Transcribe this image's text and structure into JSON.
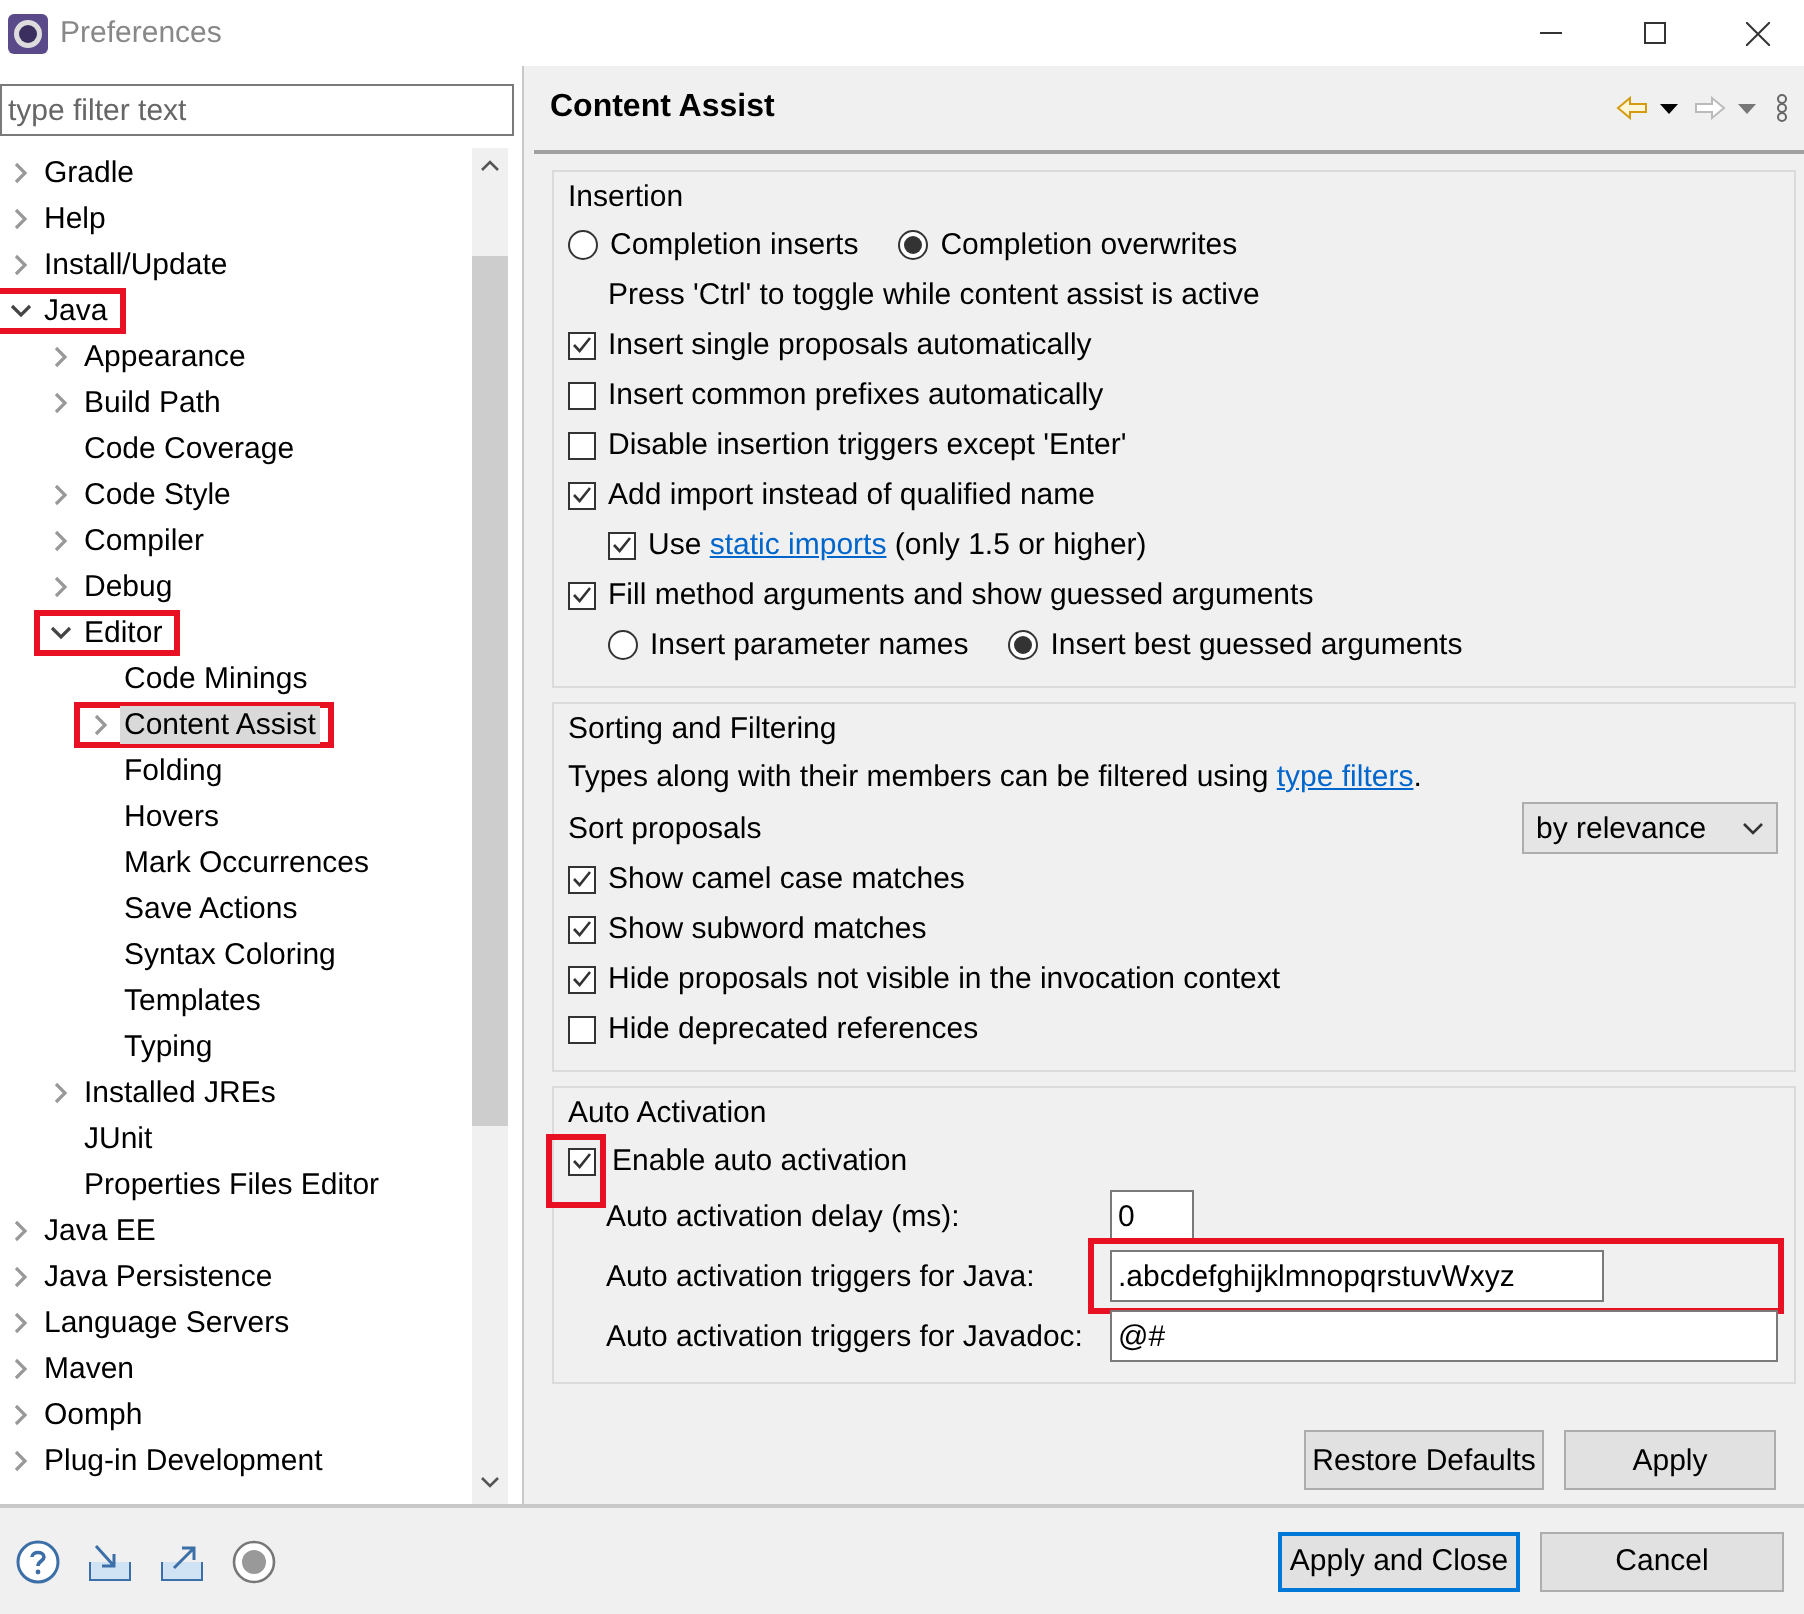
{
  "window": {
    "title": "Preferences"
  },
  "filter": {
    "placeholder": "type filter text"
  },
  "tree": [
    {
      "label": "Gradle",
      "kind": "branch",
      "expanded": false,
      "selected": false,
      "highlighted": false
    },
    {
      "label": "Help",
      "kind": "branch",
      "expanded": false,
      "selected": false,
      "highlighted": false
    },
    {
      "label": "Install/Update",
      "kind": "branch",
      "expanded": false,
      "selected": false,
      "highlighted": false
    },
    {
      "label": "Java",
      "kind": "branch",
      "expanded": true,
      "selected": false,
      "highlighted": true,
      "children": [
        {
          "label": "Appearance",
          "kind": "branch",
          "expanded": false,
          "selected": false,
          "highlighted": false
        },
        {
          "label": "Build Path",
          "kind": "branch",
          "expanded": false,
          "selected": false,
          "highlighted": false
        },
        {
          "label": "Code Coverage",
          "kind": "leaf",
          "selected": false,
          "highlighted": false
        },
        {
          "label": "Code Style",
          "kind": "branch",
          "expanded": false,
          "selected": false,
          "highlighted": false
        },
        {
          "label": "Compiler",
          "kind": "branch",
          "expanded": false,
          "selected": false,
          "highlighted": false
        },
        {
          "label": "Debug",
          "kind": "branch",
          "expanded": false,
          "selected": false,
          "highlighted": false
        },
        {
          "label": "Editor",
          "kind": "branch",
          "expanded": true,
          "selected": false,
          "highlighted": true,
          "children": [
            {
              "label": "Code Minings",
              "kind": "leaf",
              "selected": false,
              "highlighted": false
            },
            {
              "label": "Content Assist",
              "kind": "branch",
              "expanded": false,
              "selected": true,
              "highlighted": true
            },
            {
              "label": "Folding",
              "kind": "leaf",
              "selected": false,
              "highlighted": false
            },
            {
              "label": "Hovers",
              "kind": "leaf",
              "selected": false,
              "highlighted": false
            },
            {
              "label": "Mark Occurrences",
              "kind": "leaf",
              "selected": false,
              "highlighted": false
            },
            {
              "label": "Save Actions",
              "kind": "leaf",
              "selected": false,
              "highlighted": false
            },
            {
              "label": "Syntax Coloring",
              "kind": "leaf",
              "selected": false,
              "highlighted": false
            },
            {
              "label": "Templates",
              "kind": "leaf",
              "selected": false,
              "highlighted": false
            },
            {
              "label": "Typing",
              "kind": "leaf",
              "selected": false,
              "highlighted": false
            }
          ]
        },
        {
          "label": "Installed JREs",
          "kind": "branch",
          "expanded": false,
          "selected": false,
          "highlighted": false
        },
        {
          "label": "JUnit",
          "kind": "leaf",
          "selected": false,
          "highlighted": false
        },
        {
          "label": "Properties Files Editor",
          "kind": "leaf",
          "selected": false,
          "highlighted": false
        }
      ]
    },
    {
      "label": "Java EE",
      "kind": "branch",
      "expanded": false,
      "selected": false,
      "highlighted": false
    },
    {
      "label": "Java Persistence",
      "kind": "branch",
      "expanded": false,
      "selected": false,
      "highlighted": false
    },
    {
      "label": "Language Servers",
      "kind": "branch",
      "expanded": false,
      "selected": false,
      "highlighted": false
    },
    {
      "label": "Maven",
      "kind": "branch",
      "expanded": false,
      "selected": false,
      "highlighted": false
    },
    {
      "label": "Oomph",
      "kind": "branch",
      "expanded": false,
      "selected": false,
      "highlighted": false
    },
    {
      "label": "Plug-in Development",
      "kind": "branch",
      "expanded": false,
      "selected": false,
      "highlighted": false
    }
  ],
  "page": {
    "title": "Content Assist",
    "groups": [
      {
        "title": "Insertion",
        "rows": [
          {
            "kind": "radios",
            "options": [
              {
                "label": "Completion inserts",
                "selected": false
              },
              {
                "label": "Completion overwrites",
                "selected": true
              }
            ]
          },
          {
            "kind": "note",
            "text": "Press 'Ctrl' to toggle while content assist is active"
          },
          {
            "kind": "checkbox",
            "label": "Insert single proposals automatically",
            "checked": true
          },
          {
            "kind": "checkbox",
            "label": "Insert common prefixes automatically",
            "checked": false
          },
          {
            "kind": "checkbox",
            "label": "Disable insertion triggers except 'Enter'",
            "checked": false
          },
          {
            "kind": "checkbox",
            "label": "Add import instead of qualified name",
            "checked": true,
            "children": [
              {
                "kind": "checkbox",
                "label": "Use",
                "link": "static imports",
                "label_after": "(only 1.5 or higher)",
                "checked": true
              }
            ]
          },
          {
            "kind": "checkbox",
            "label": "Fill method arguments and show guessed arguments",
            "checked": true,
            "children": [
              {
                "kind": "radios",
                "options": [
                  {
                    "label": "Insert parameter names",
                    "selected": false
                  },
                  {
                    "label": "Insert best guessed arguments",
                    "selected": true
                  }
                ]
              }
            ]
          }
        ]
      },
      {
        "title": "Sorting and Filtering",
        "rows": [
          {
            "kind": "note",
            "text": "Types along with their members can be filtered using",
            "link": "type filters",
            "label_after": "."
          },
          {
            "kind": "select",
            "label": "Sort proposals",
            "value": "by relevance"
          },
          {
            "kind": "checkbox",
            "label": "Show camel case matches",
            "checked": true
          },
          {
            "kind": "checkbox",
            "label": "Show subword matches",
            "checked": true
          },
          {
            "kind": "checkbox",
            "label": "Hide proposals not visible in the invocation context",
            "checked": true
          },
          {
            "kind": "checkbox",
            "label": "Hide deprecated references",
            "checked": false
          }
        ]
      },
      {
        "title": "Auto Activation",
        "rows": [
          {
            "kind": "checkbox",
            "label": "Enable auto activation",
            "checked": true,
            "highlighted": true,
            "children": [
              {
                "kind": "field",
                "label": "Auto activation delay (ms):",
                "value": "0",
                "short": true,
                "highlighted": false
              },
              {
                "kind": "field",
                "label": "Auto activation triggers for Java:",
                "value": ".abcdefghijklmnopqrstuvWxyz",
                "short": false,
                "highlighted": true
              },
              {
                "kind": "field",
                "label": "Auto activation triggers for Javadoc:",
                "value": "@#",
                "short": false,
                "highlighted": false
              }
            ]
          }
        ]
      }
    ],
    "buttons": [
      "Restore Defaults",
      "Apply"
    ]
  },
  "footer": {
    "buttons": [
      {
        "label": "Apply and Close",
        "default": true
      },
      {
        "label": "Cancel",
        "default": false
      }
    ]
  }
}
